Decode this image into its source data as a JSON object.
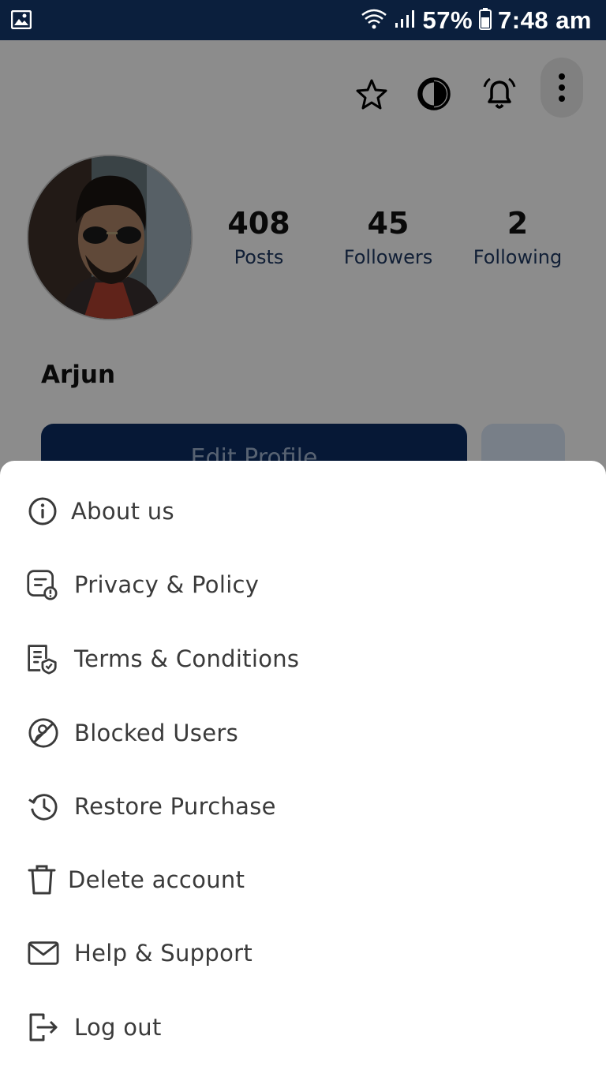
{
  "status_bar": {
    "battery": "57%",
    "time": "7:48 am"
  },
  "profile": {
    "name": "Arjun",
    "stats": [
      {
        "value": "408",
        "label": "Posts"
      },
      {
        "value": "45",
        "label": "Followers"
      },
      {
        "value": "2",
        "label": "Following"
      }
    ],
    "edit_button_label": "Edit Profile"
  },
  "menu": {
    "items": [
      {
        "label": "About us",
        "icon": "info-icon"
      },
      {
        "label": "Privacy & Policy",
        "icon": "privacy-doc-icon"
      },
      {
        "label": "Terms & Conditions",
        "icon": "terms-doc-icon"
      },
      {
        "label": "Blocked Users",
        "icon": "blocked-user-icon"
      },
      {
        "label": "Restore Purchase",
        "icon": "history-icon"
      },
      {
        "label": "Delete account",
        "icon": "trash-icon"
      },
      {
        "label": "Help & Support",
        "icon": "mail-icon"
      },
      {
        "label": "Log out",
        "icon": "logout-icon"
      }
    ]
  },
  "colors": {
    "status_bar_bg": "#0b1f3d",
    "primary": "#0b2d63",
    "overlay": "rgba(0,0,0,0.45)",
    "menu_text": "#3a3a3a"
  }
}
